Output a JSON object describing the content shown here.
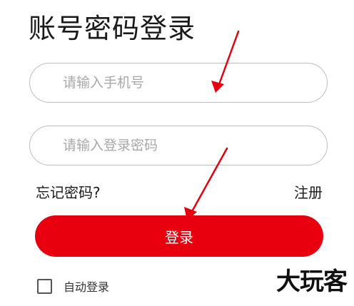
{
  "page": {
    "title": "账号密码登录"
  },
  "form": {
    "phone_placeholder": "请输入手机号",
    "password_placeholder": "请输入登录密码",
    "forgot_password_label": "忘记密码?",
    "register_label": "注册",
    "login_button_label": "登录",
    "auto_login_label": "自动登录",
    "auto_login_checked": false
  },
  "watermark": {
    "text": "大玩客"
  },
  "annotations": {
    "arrow_count": 2
  },
  "colors": {
    "accent": "#e8000f",
    "annotation_arrow": "#e8000f",
    "field_border": "#bdbdbd",
    "placeholder": "#a8a8a8"
  }
}
